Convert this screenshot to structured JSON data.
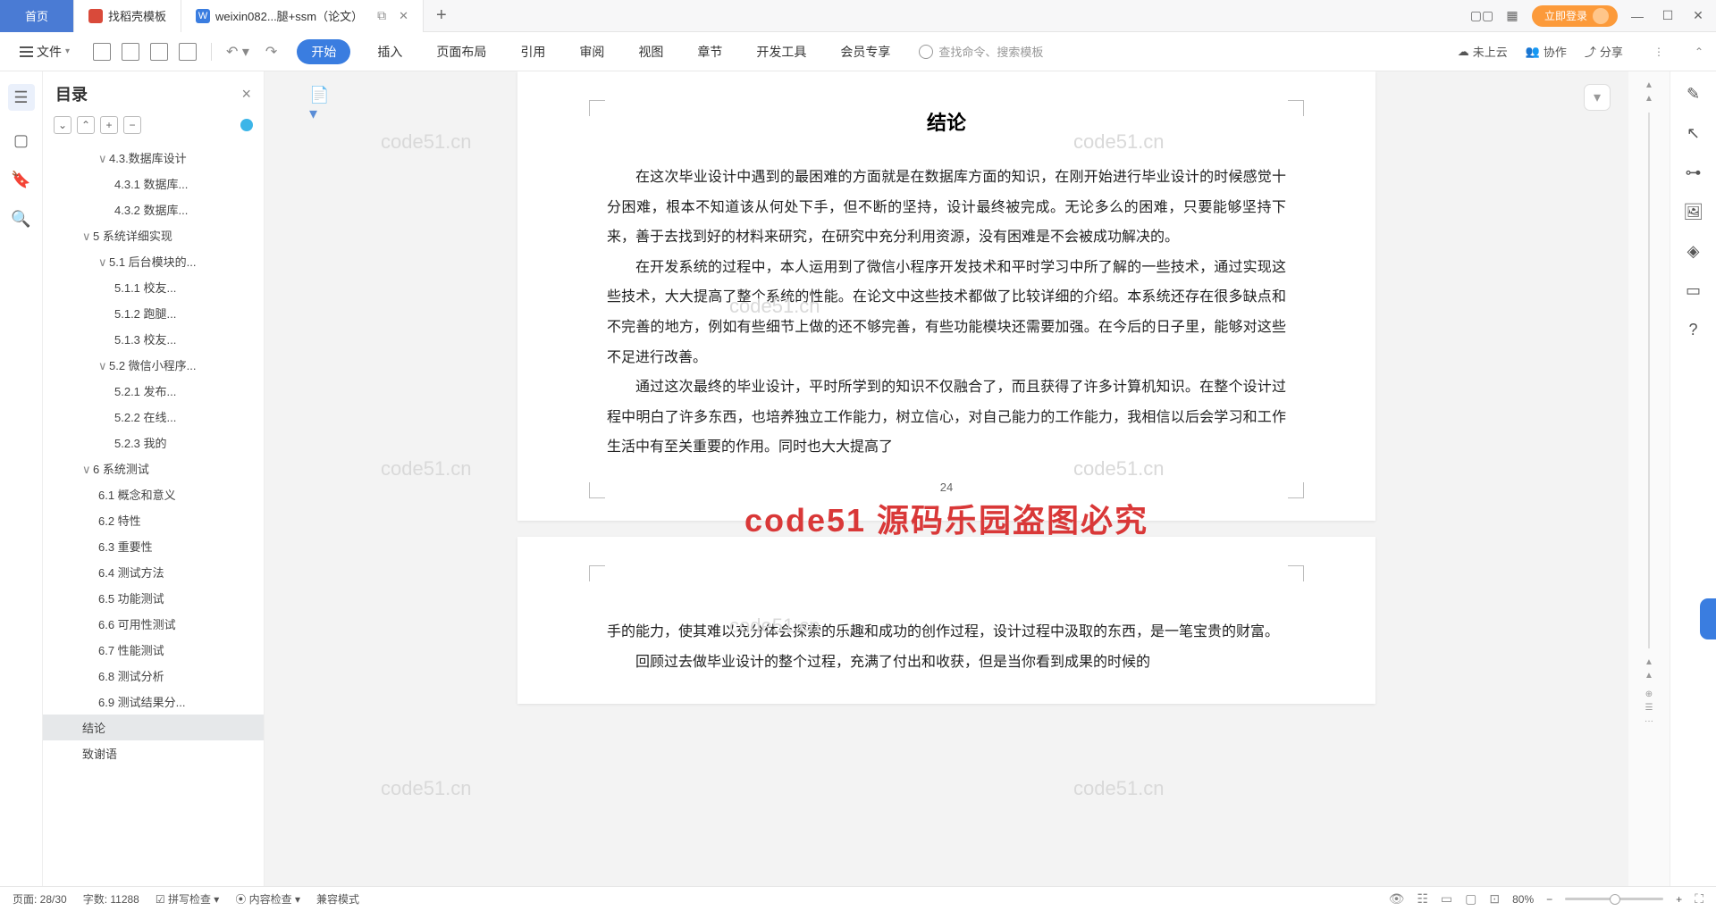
{
  "titlebar": {
    "home": "首页",
    "template_tab": "找稻壳模板",
    "doc_tab": "weixin082...腿+ssm（论文）",
    "login": "立即登录"
  },
  "menubar": {
    "file": "文件",
    "tabs": [
      "开始",
      "插入",
      "页面布局",
      "引用",
      "审阅",
      "视图",
      "章节",
      "开发工具",
      "会员专享"
    ],
    "search_placeholder": "查找命令、搜索模板",
    "cloud": "未上云",
    "coop": "协作",
    "share": "分享"
  },
  "outline": {
    "title": "目录",
    "items": [
      {
        "lvl": 2,
        "txt": "4.3.数据库设计",
        "caret": "∨"
      },
      {
        "lvl": 3,
        "txt": "4.3.1 数据库..."
      },
      {
        "lvl": 3,
        "txt": "4.3.2 数据库..."
      },
      {
        "lvl": 1,
        "txt": "5 系统详细实现",
        "caret": "∨"
      },
      {
        "lvl": 2,
        "txt": "5.1 后台模块的...",
        "caret": "∨"
      },
      {
        "lvl": 3,
        "txt": "5.1.1 校友..."
      },
      {
        "lvl": 3,
        "txt": "5.1.2 跑腿..."
      },
      {
        "lvl": 3,
        "txt": "5.1.3 校友..."
      },
      {
        "lvl": 2,
        "txt": "5.2 微信小程序...",
        "caret": "∨"
      },
      {
        "lvl": 3,
        "txt": "5.2.1 发布..."
      },
      {
        "lvl": 3,
        "txt": "5.2.2 在线..."
      },
      {
        "lvl": 3,
        "txt": "5.2.3 我的"
      },
      {
        "lvl": 1,
        "txt": "6 系统测试",
        "caret": "∨"
      },
      {
        "lvl": 2,
        "txt": "6.1 概念和意义"
      },
      {
        "lvl": 2,
        "txt": "6.2 特性"
      },
      {
        "lvl": 2,
        "txt": "6.3 重要性"
      },
      {
        "lvl": 2,
        "txt": "6.4 测试方法"
      },
      {
        "lvl": 2,
        "txt": "6.5 功能测试"
      },
      {
        "lvl": 2,
        "txt": "6.6 可用性测试"
      },
      {
        "lvl": 2,
        "txt": "6.7 性能测试"
      },
      {
        "lvl": 2,
        "txt": "6.8 测试分析"
      },
      {
        "lvl": 2,
        "txt": "6.9 测试结果分..."
      },
      {
        "lvl": 1,
        "txt": "结论",
        "sel": true
      },
      {
        "lvl": 1,
        "txt": "致谢语"
      }
    ]
  },
  "doc": {
    "heading": "结论",
    "page_number": "24",
    "p1": "在这次毕业设计中遇到的最困难的方面就是在数据库方面的知识，在刚开始进行毕业设计的时候感觉十分困难，根本不知道该从何处下手，但不断的坚持，设计最终被完成。无论多么的困难，只要能够坚持下来，善于去找到好的材料来研究，在研究中充分利用资源，没有困难是不会被成功解决的。",
    "p2": "在开发系统的过程中，本人运用到了微信小程序开发技术和平时学习中所了解的一些技术，通过实现这些技术，大大提高了整个系统的性能。在论文中这些技术都做了比较详细的介绍。本系统还存在很多缺点和不完善的地方，例如有些细节上做的还不够完善，有些功能模块还需要加强。在今后的日子里，能够对这些不足进行改善。",
    "p3": "通过这次最终的毕业设计，平时所学到的知识不仅融合了，而且获得了许多计算机知识。在整个设计过程中明白了许多东西，也培养独立工作能力，树立信心，对自己能力的工作能力，我相信以后会学习和工作生活中有至关重要的作用。同时也大大提高了",
    "p4": "手的能力，使其难以充分体会探索的乐趣和成功的创作过程，设计过程中汲取的东西，是一笔宝贵的财富。",
    "p5": "回顾过去做毕业设计的整个过程，充满了付出和收获，但是当你看到成果的时候的",
    "watermark": "code51.cn",
    "red_overlay": "code51    源码乐园盗图必究"
  },
  "status": {
    "page": "页面: 28/30",
    "words": "字数: 11288",
    "spell": "拼写检查",
    "content": "内容检查",
    "compat": "兼容模式",
    "zoom": "80%"
  }
}
